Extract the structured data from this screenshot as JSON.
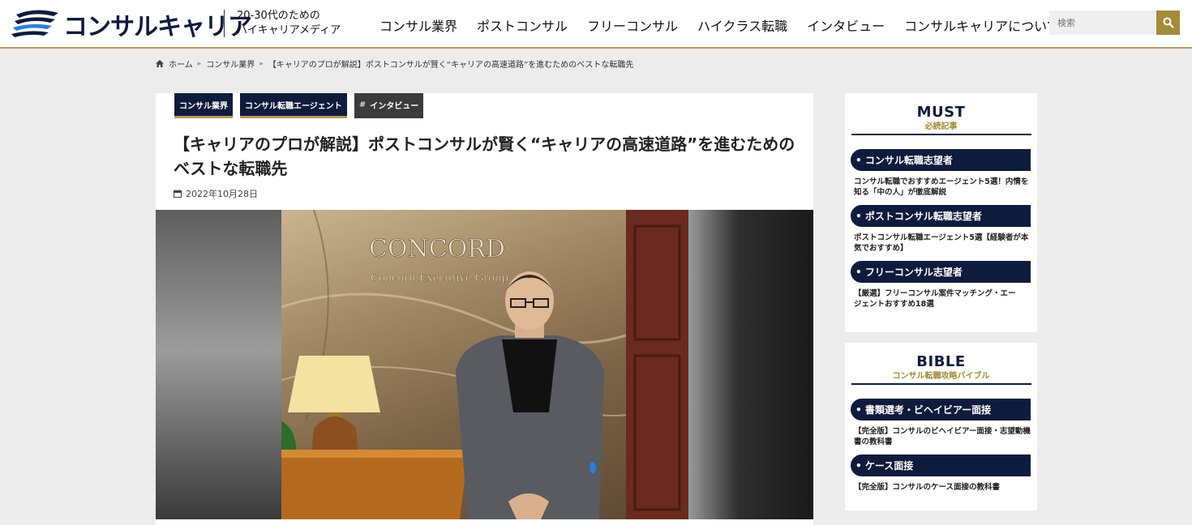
{
  "header": {
    "logo_text": "コンサルキャリア",
    "tagline_line1": "20-30代のための",
    "tagline_line2": "ハイキャリアメディア",
    "nav": [
      "コンサル業界",
      "ポストコンサル",
      "フリーコンサル",
      "ハイクラス転職",
      "インタビュー",
      "コンサルキャリアについて"
    ],
    "search_placeholder": "検索",
    "logo_icon": "wing-logo-icon",
    "search_icon": "search-icon"
  },
  "breadcrumb": {
    "home": "ホーム",
    "category": "コンサル業界",
    "current": "【キャリアのプロが解説】ポストコンサルが賢く“キャリアの高速道路”を進むためのベストな転職先"
  },
  "article": {
    "tags": [
      "コンサル業界",
      "コンサル転職エージェント"
    ],
    "hash_tag_symbol": "#",
    "hash_tag": "インタビュー",
    "title_line1": "【キャリアのプロが解説】ポストコンサルが賢く“キャリアの高速道路”を進むための",
    "title_line2": "ベストな転職先",
    "date": "2022年10月28日",
    "date_icon": "calendar-icon",
    "hero_sign_line1": "CONCORD",
    "hero_sign_line2": "Concord Executive Group"
  },
  "sidebar": {
    "must": {
      "heading": "MUST",
      "sub": "必読記事",
      "items": [
        {
          "category": "• コンサル転職志望者",
          "link_line1": "コンサル転職でおすすめエージェント5選！内情を",
          "link_line2": "知る「中の人」が徹底解説"
        },
        {
          "category": "• ポストコンサル転職志望者",
          "link_line1": "ポストコンサル転職エージェント5選【経験者が本",
          "link_line2": "気でおすすめ】"
        },
        {
          "category": "• フリーコンサル志望者",
          "link_line1": "【厳選】フリーコンサル案件マッチング・エー",
          "link_line2": "ジェントおすすめ18選"
        }
      ]
    },
    "bible": {
      "heading": "BIBLE",
      "sub": "コンサル転職攻略バイブル",
      "items": [
        {
          "category": "• 書類選考・ビヘイビアー面接",
          "link_line1": "【完全版】コンサルのビヘイビアー面接・志望動機",
          "link_line2": "書の教科書"
        },
        {
          "category": "• ケース面接",
          "link_line1": "【完全版】コンサルのケース面接の教科書",
          "link_line2": ""
        }
      ]
    }
  },
  "colors": {
    "navy": "#0f1b3d",
    "gold": "#a48b3a",
    "background": "#ececec"
  }
}
